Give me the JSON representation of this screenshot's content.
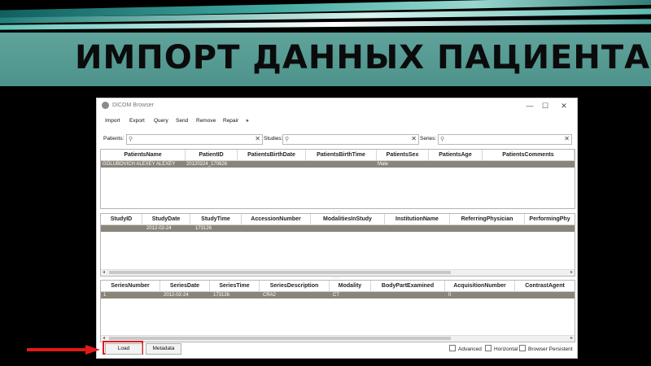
{
  "slide_title": "ИМПОРТ ДАННЫХ ПАЦИЕНТА",
  "window": {
    "title": "DICOM Browser",
    "minimize_glyph": "—",
    "maximize_glyph": "☐",
    "close_glyph": "✕"
  },
  "menu": {
    "items": [
      "Import",
      "Export",
      "Query",
      "Send",
      "Remove",
      "Repair"
    ],
    "overflow": "»"
  },
  "filters": {
    "patients_label": "Patients:",
    "studies_label": "Studies:",
    "series_label": "Series:",
    "search_icon": "magnifier-icon",
    "clear_glyph": "✕"
  },
  "patients_table": {
    "columns": [
      "PatientsName",
      "PatientID",
      "PatientsBirthDate",
      "PatientsBirthTime",
      "PatientsSex",
      "PatientsAge",
      "PatientsComments"
    ],
    "rows": [
      [
        "GOLUBOVICH ALEXEY ALEXEY",
        "20120224_170826",
        "",
        "",
        "Male",
        "",
        ""
      ]
    ]
  },
  "studies_table": {
    "columns": [
      "StudyID",
      "StudyDate",
      "StudyTime",
      "AccessionNumber",
      "ModalitiesInStudy",
      "InstitutionName",
      "ReferringPhysician",
      "PerformingPhy"
    ],
    "rows": [
      [
        "",
        "2012-02-24",
        "173126",
        "",
        "",
        "",
        "",
        ""
      ]
    ]
  },
  "series_table": {
    "columns": [
      "SeriesNumber",
      "SeriesDate",
      "SeriesTime",
      "SeriesDescription",
      "Modality",
      "BodyPartExamined",
      "AcquisitionNumber",
      "ContrastAgent"
    ],
    "rows": [
      [
        "1",
        "2012-02-24",
        "173126",
        "CRA2",
        "CT",
        "",
        "0",
        ""
      ]
    ]
  },
  "buttons": {
    "load": "Load",
    "metadata": "Metadata"
  },
  "checkboxes": {
    "advanced": "Advanced",
    "horizontal": "Horizontal",
    "browser_persistent": "Browser Persistent"
  },
  "colors": {
    "title_band": "#5fa39b",
    "selected_row": "#8a857a",
    "highlight": "#e01a1a"
  }
}
